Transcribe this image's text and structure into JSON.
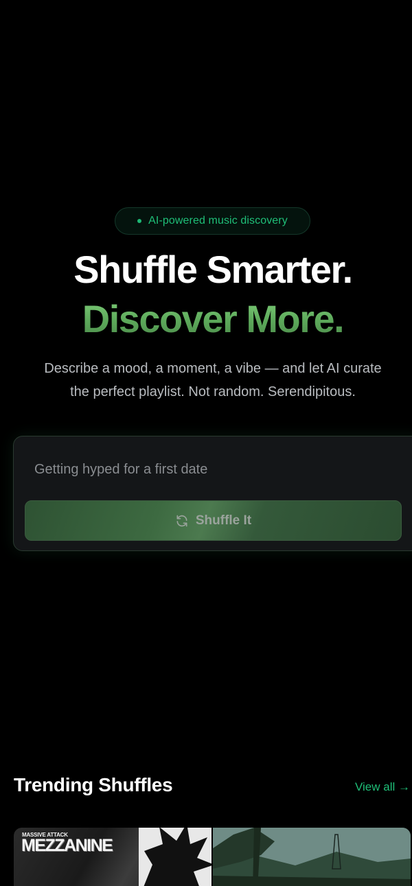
{
  "hero": {
    "badge_text": "AI-powered music discovery",
    "title_line1": "Shuffle Smarter.",
    "title_line2": "Discover More.",
    "subtitle_line1": "Describe a mood, a moment, a vibe — and let AI curate",
    "subtitle_line2": "the perfect playlist. Not random. Serendipitous."
  },
  "prompt": {
    "placeholder": "Getting hyped for a first date",
    "value": ""
  },
  "shuffle_button": {
    "label": "Shuffle It",
    "icon": "refresh-icon"
  },
  "trending": {
    "title": "Trending Shuffles",
    "view_all_label": "View all →",
    "cards": [
      {
        "artist": "MASSIVE ATTACK",
        "album": "MEZZANINE",
        "artwork": "album-cover"
      },
      {
        "artwork": "mountain-landscape-cover"
      }
    ]
  },
  "colors": {
    "background": "#000000",
    "accent_green": "#1fbf78",
    "title_gradient_green": "#6fbf6f",
    "button_green": "#3d6a41",
    "card_bg": "#141618",
    "muted_text": "#b9bcc0"
  }
}
